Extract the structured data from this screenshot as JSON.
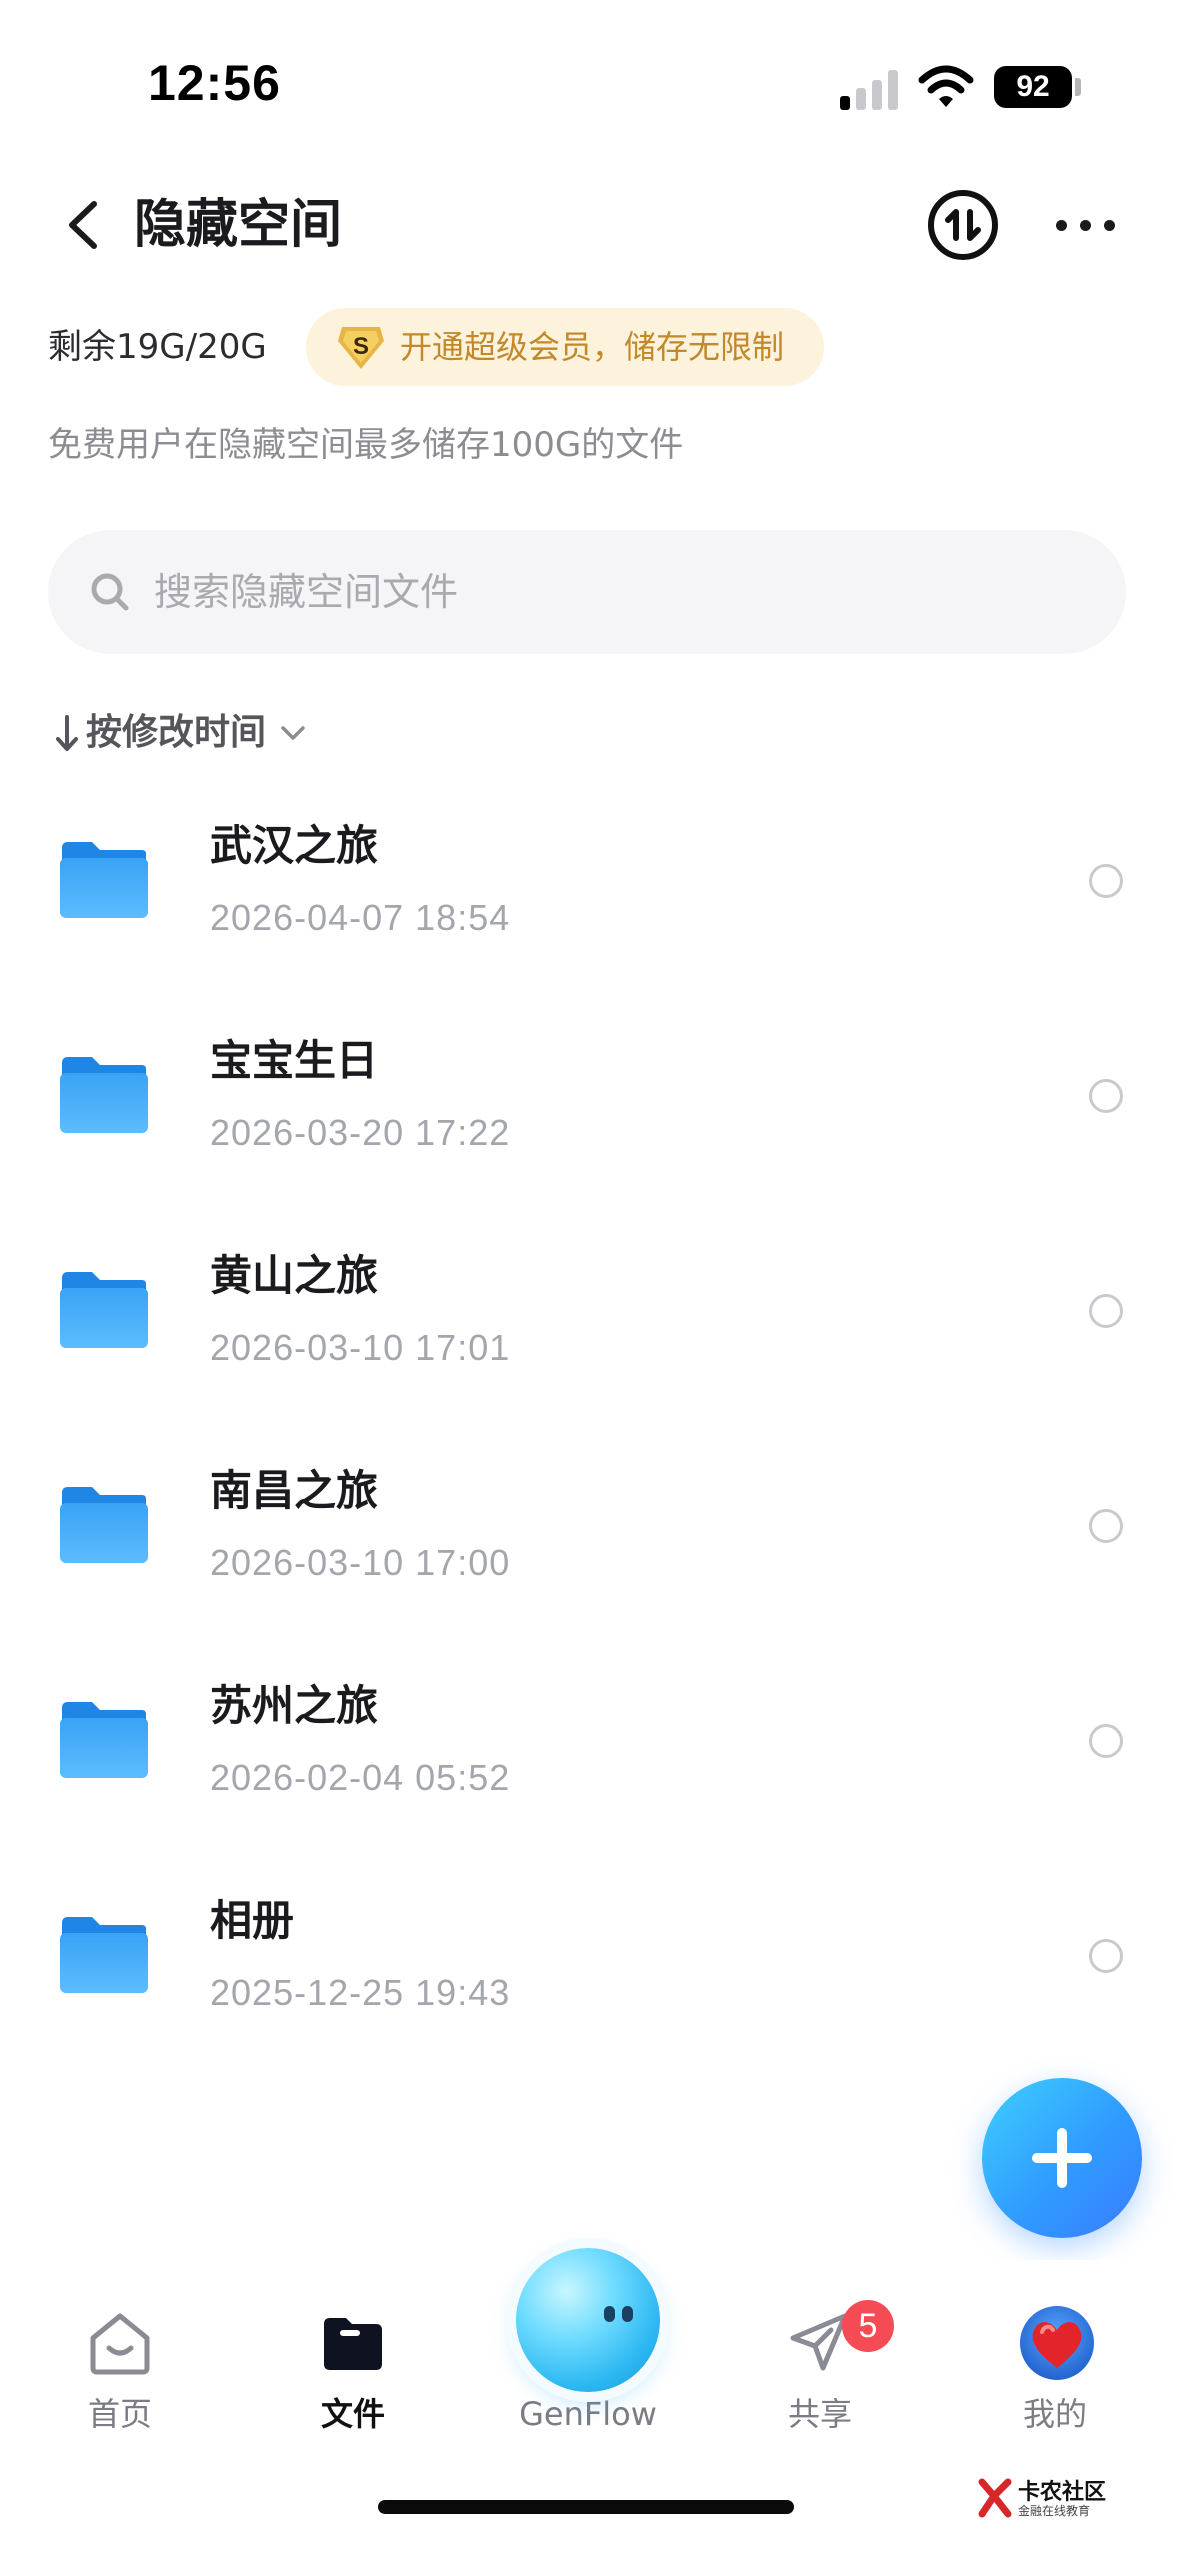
{
  "status_bar": {
    "time": "12:56",
    "battery": "92"
  },
  "header": {
    "title": "隐藏空间"
  },
  "storage": {
    "remaining": "剩余19G/20G",
    "vip_badge_letter": "S",
    "vip_promo": "开通超级会员，储存无限制",
    "note": "免费用户在隐藏空间最多储存100G的文件"
  },
  "search": {
    "placeholder": "搜索隐藏空间文件",
    "value": ""
  },
  "sort": {
    "label": "按修改时间"
  },
  "files": [
    {
      "name": "武汉之旅",
      "date": "2026-04-07 18:54"
    },
    {
      "name": "宝宝生日",
      "date": "2026-03-20 17:22"
    },
    {
      "name": "黄山之旅",
      "date": "2026-03-10 17:01"
    },
    {
      "name": "南昌之旅",
      "date": "2026-03-10 17:00"
    },
    {
      "name": "苏州之旅",
      "date": "2026-02-04 05:52"
    },
    {
      "name": "相册",
      "date": "2025-12-25 19:43"
    }
  ],
  "tabs": [
    {
      "label": "首页",
      "icon": "home-icon",
      "active": false
    },
    {
      "label": "文件",
      "icon": "folder-icon",
      "active": true
    },
    {
      "label": "GenFlow",
      "icon": "genflow-orb",
      "active": false
    },
    {
      "label": "共享",
      "icon": "paper-plane-icon",
      "active": false,
      "badge": "5"
    },
    {
      "label": "我的",
      "icon": "avatar",
      "active": false
    }
  ],
  "watermark": {
    "title": "卡农社区",
    "subtitle": "金融在线教育"
  },
  "colors": {
    "accent": "#2f9bff",
    "vip_text": "#c2882a",
    "vip_bg": "#fdf3dc",
    "badge": "#f54b55",
    "folder": "#3aa3f5"
  }
}
